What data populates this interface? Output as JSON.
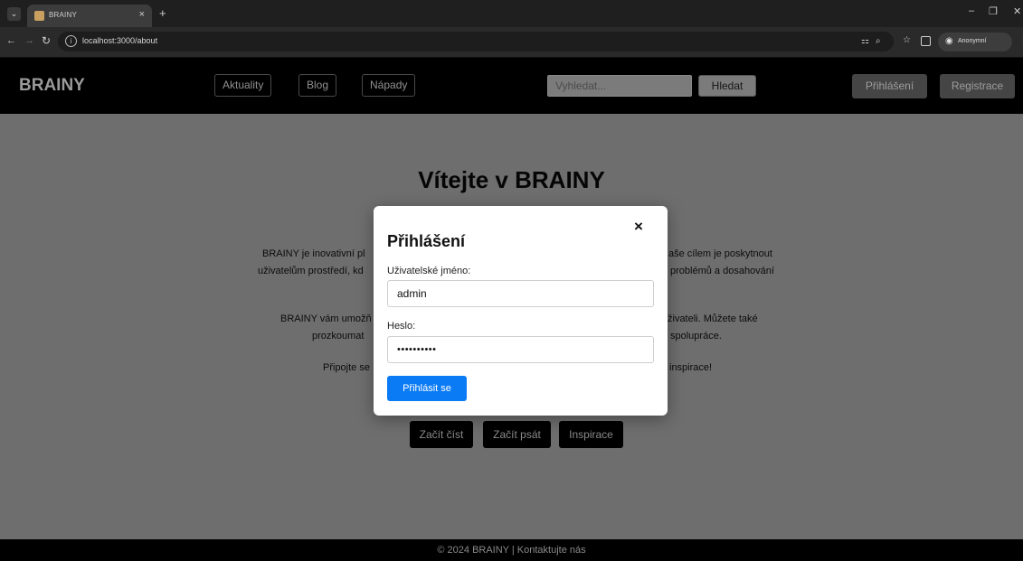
{
  "browser": {
    "tab_title": "BRAINY",
    "tab_close": "×",
    "new_tab": "+",
    "url": "localhost:3000/about",
    "profile_label": "Anonymní",
    "window_min": "–",
    "window_max": "❐",
    "window_close": "✕"
  },
  "header": {
    "brand": "BRAINY",
    "nav": [
      "Aktuality",
      "Blog",
      "Nápady"
    ],
    "search_placeholder": "Vyhledat...",
    "search_button": "Hledat",
    "login_button": "Přihlášení",
    "register_button": "Registrace"
  },
  "main": {
    "title": "Vítejte v BRAINY",
    "paragraph1_line1_left": "BRAINY je inovativní pl",
    "paragraph1_line1_right": "aše cílem je poskytnout",
    "paragraph1_line2_left": "uživatelům prostředí, kd",
    "paragraph1_line2_right": "problémů a dosahování",
    "paragraph2_line1_left": "BRAINY vám umožň",
    "paragraph2_line1_right": "živateli. Můžete také",
    "paragraph2_line2_left": "prozkoumat",
    "paragraph2_line2_right": "spolupráce.",
    "paragraph3_left": "Připojte se",
    "paragraph3_right": "inspirace!",
    "cta_buttons": [
      "Začít číst",
      "Začít psát",
      "Inspirace"
    ]
  },
  "footer": {
    "text": "© 2024 BRAINY | Kontaktujte nás"
  },
  "modal": {
    "title": "Přihlášení",
    "close": "×",
    "username_label": "Uživatelské jméno:",
    "username_value": "admin",
    "password_label": "Heslo:",
    "password_value": "••••••••••",
    "submit": "Přihlásit se"
  }
}
